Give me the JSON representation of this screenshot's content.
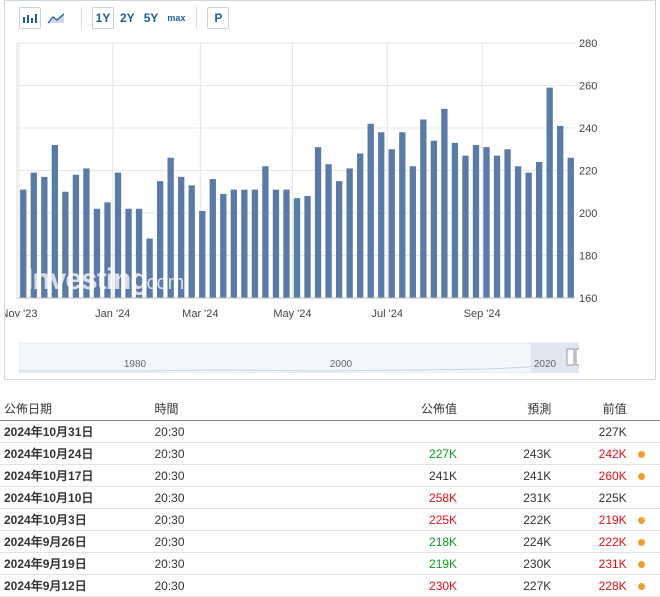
{
  "toolbar": {
    "range_buttons": [
      "1Y",
      "2Y",
      "5Y",
      "max"
    ],
    "p_label": "P"
  },
  "colors": {
    "bar": "#5a7ba5",
    "grid": "#e5e5e5",
    "green": "#0a9a1d",
    "red": "#e0101a",
    "dot": "#f0a030"
  },
  "watermark": {
    "text": "Investing",
    "suffix": ".com"
  },
  "chart_data": {
    "type": "bar",
    "x_tick_labels": [
      "Nov '23",
      "Jan '24",
      "Mar '24",
      "May '24",
      "Jul '24",
      "Sep '24"
    ],
    "y_ticks": [
      160,
      180,
      200,
      220,
      240,
      260,
      280
    ],
    "ylim": [
      160,
      280
    ],
    "values": [
      211,
      219,
      217,
      232,
      210,
      218,
      221,
      202,
      205,
      219,
      202,
      202,
      188,
      215,
      226,
      217,
      213,
      201,
      216,
      209,
      211,
      211,
      211,
      222,
      211,
      211,
      207,
      208,
      231,
      223,
      215,
      221,
      228,
      242,
      238,
      230,
      238,
      222,
      244,
      234,
      249,
      233,
      227,
      232,
      231,
      227,
      230,
      222,
      219,
      224,
      259,
      241,
      226
    ],
    "grid": true,
    "y_axis_position": "right"
  },
  "navigator": {
    "labels": [
      "1980",
      "2000",
      "2020"
    ]
  },
  "table": {
    "headers": {
      "date": "公佈日期",
      "time": "時間",
      "actual": "公佈值",
      "forecast": "預測",
      "previous": "前值"
    },
    "rows": [
      {
        "date": "2024年10月31日",
        "time": "20:30",
        "actual": "",
        "actual_color": "",
        "forecast": "",
        "previous": "227K",
        "previous_color": "",
        "revised": false
      },
      {
        "date": "2024年10月24日",
        "time": "20:30",
        "actual": "227K",
        "actual_color": "green",
        "forecast": "243K",
        "previous": "242K",
        "previous_color": "red",
        "revised": true
      },
      {
        "date": "2024年10月17日",
        "time": "20:30",
        "actual": "241K",
        "actual_color": "",
        "forecast": "241K",
        "previous": "260K",
        "previous_color": "red",
        "revised": true
      },
      {
        "date": "2024年10月10日",
        "time": "20:30",
        "actual": "258K",
        "actual_color": "red",
        "forecast": "231K",
        "previous": "225K",
        "previous_color": "",
        "revised": false
      },
      {
        "date": "2024年10月3日",
        "time": "20:30",
        "actual": "225K",
        "actual_color": "red",
        "forecast": "222K",
        "previous": "219K",
        "previous_color": "red",
        "revised": true
      },
      {
        "date": "2024年9月26日",
        "time": "20:30",
        "actual": "218K",
        "actual_color": "green",
        "forecast": "224K",
        "previous": "222K",
        "previous_color": "red",
        "revised": true
      },
      {
        "date": "2024年9月19日",
        "time": "20:30",
        "actual": "219K",
        "actual_color": "green",
        "forecast": "230K",
        "previous": "231K",
        "previous_color": "red",
        "revised": true
      },
      {
        "date": "2024年9月12日",
        "time": "20:30",
        "actual": "230K",
        "actual_color": "red",
        "forecast": "227K",
        "previous": "228K",
        "previous_color": "red",
        "revised": true
      }
    ]
  }
}
